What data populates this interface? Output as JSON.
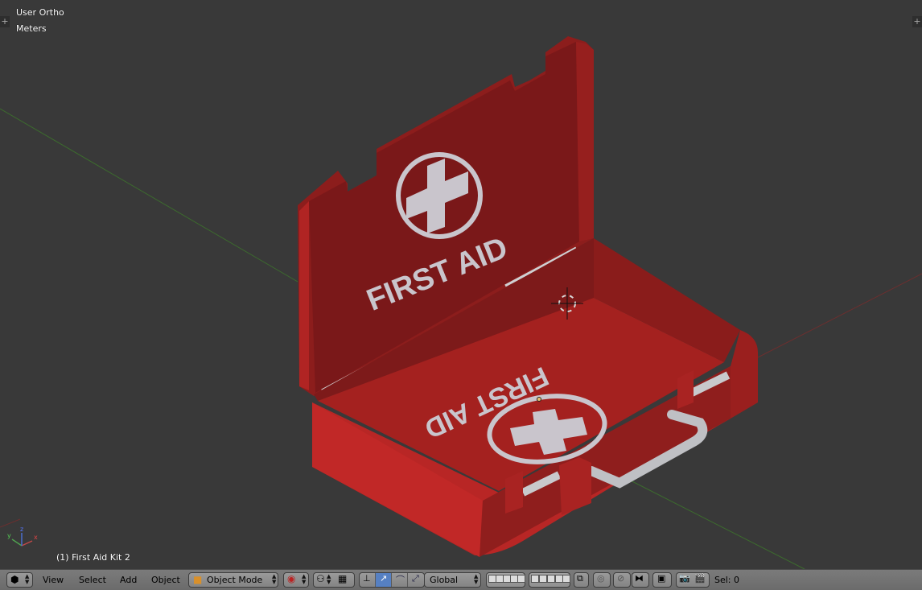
{
  "viewport": {
    "view_name": "User Ortho",
    "units": "Meters",
    "selected_object": "(1) First Aid Kit 2",
    "axis_labels": {
      "x": "x",
      "y": "y",
      "z": "z"
    },
    "model_texts": {
      "lid_label": "FIRST AID",
      "base_label": "FIRST AID"
    },
    "colors": {
      "background": "#393939",
      "case_red": "#a8201f",
      "grid_green": "#3c6b2e",
      "grid_red": "#6b2f2f"
    }
  },
  "header": {
    "editor_type_icon": "cube-icon",
    "menus": {
      "view": "View",
      "select": "Select",
      "add": "Add",
      "object": "Object"
    },
    "mode": "Object Mode",
    "transform_orientation": "Global",
    "selection_info": "Sel: 0",
    "icons": [
      "viewport-shading-icon",
      "pivot-point-icon",
      "manipulator-icon",
      "translate-icon",
      "rotate-icon",
      "scale-icon",
      "layers-icon",
      "lock-camera-icon",
      "proportional-edit-icon",
      "snap-icon",
      "snap-element-icon",
      "render-icon",
      "animation-render-icon"
    ]
  }
}
